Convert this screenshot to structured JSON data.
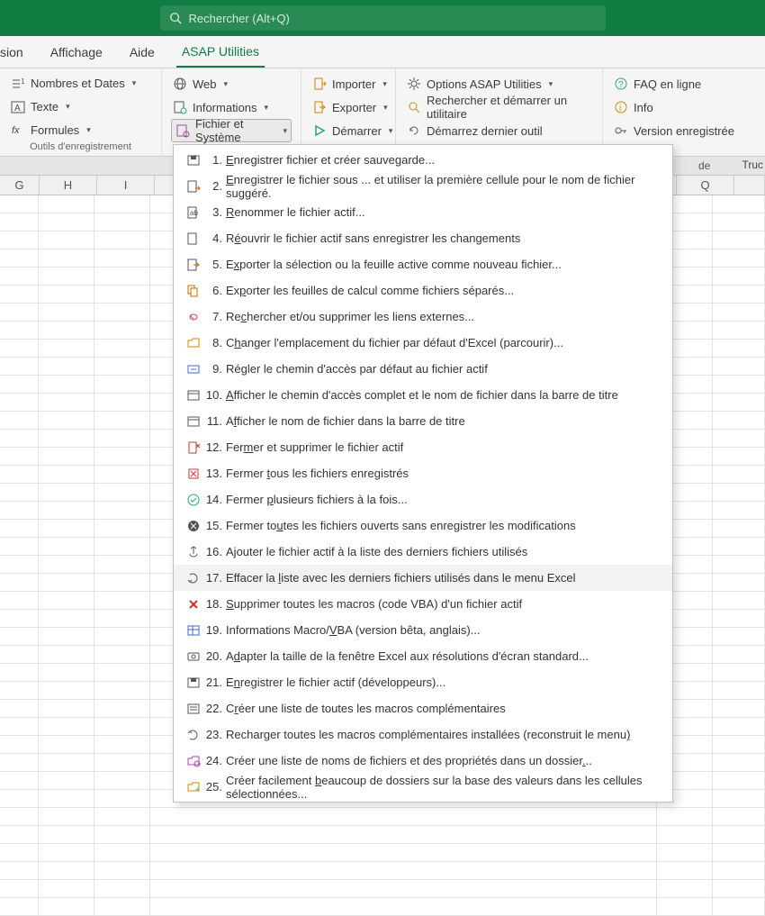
{
  "titlebar": {
    "search_placeholder": "Rechercher (Alt+Q)"
  },
  "tabs": {
    "partial": "sion",
    "affichage": "Affichage",
    "aide": "Aide",
    "asap": "ASAP Utilities"
  },
  "ribbon": {
    "group1": {
      "nombres": "Nombres et Dates",
      "texte": "Texte",
      "formules": "Formules",
      "label": "Outils d'enregistrement"
    },
    "group2": {
      "web": "Web",
      "informations": "Informations",
      "fichier": "Fichier et Système"
    },
    "group3": {
      "importer": "Importer",
      "exporter": "Exporter",
      "demarrer": "Démarrer"
    },
    "group4": {
      "options": "Options ASAP Utilities",
      "rechercher": "Rechercher et démarrer un utilitaire",
      "demarrez": "Démarrez dernier outil"
    },
    "group5": {
      "faq": "FAQ en ligne",
      "info": "Info",
      "version": "Version enregistrée"
    }
  },
  "partial_right_header": "de",
  "truncated_right": "Truc",
  "columns": [
    "G",
    "H",
    "I",
    "",
    "",
    "",
    "",
    "",
    "",
    "",
    "Q"
  ],
  "menu": {
    "items": [
      {
        "n": "1.",
        "u": "E",
        "t": "nregistrer fichier et créer sauvegarde..."
      },
      {
        "n": "2.",
        "u": "E",
        "t": "nregistrer le fichier sous ... et utiliser la première cellule pour le nom de fichier suggéré."
      },
      {
        "n": "3.",
        "u": "R",
        "t": "enommer le fichier actif..."
      },
      {
        "n": "4.",
        "pre": "R",
        "u": "é",
        "t": "ouvrir le fichier actif sans enregistrer les changements"
      },
      {
        "n": "5.",
        "pre": "E",
        "u": "x",
        "t": "porter la sélection ou la feuille active comme nouveau fichier..."
      },
      {
        "n": "6.",
        "pre": "Ex",
        "u": "p",
        "t": "orter les feuilles de calcul comme fichiers séparés..."
      },
      {
        "n": "7.",
        "pre": "Re",
        "u": "c",
        "t": "hercher et/ou supprimer les liens externes..."
      },
      {
        "n": "8.",
        "pre": "C",
        "u": "h",
        "t": "anger l'emplacement du fichier par défaut d'Excel (parcourir)..."
      },
      {
        "n": "9.",
        "pre": "Ré",
        "u": "g",
        "t": "ler le chemin d'accès par défaut au fichier actif"
      },
      {
        "n": "10.",
        "u": "A",
        "t": "fficher le chemin d'accès complet et le nom de fichier dans la barre de titre"
      },
      {
        "n": "11.",
        "pre": "A",
        "u": "f",
        "t": "ficher le nom de fichier dans la barre de titre"
      },
      {
        "n": "12.",
        "pre": "Fer",
        "u": "m",
        "t": "er et supprimer le fichier actif"
      },
      {
        "n": "13.",
        "pre": "Fermer ",
        "u": "t",
        "t": "ous les fichiers enregistrés"
      },
      {
        "n": "14.",
        "pre": "Fermer ",
        "u": "p",
        "t": "lusieurs fichiers à la fois..."
      },
      {
        "n": "15.",
        "pre": "Fermer to",
        "u": "u",
        "t": "tes les fichiers ouverts sans enregistrer les modifications"
      },
      {
        "n": "16.",
        "pre": "A",
        "u": "j",
        "t": "outer le fichier actif  à la liste des derniers fichiers utilisés"
      },
      {
        "n": "17.",
        "pre": "Effacer la ",
        "u": "l",
        "t": "iste avec les derniers fichiers utilisés dans le menu Excel"
      },
      {
        "n": "18.",
        "u": "S",
        "t": "upprimer toutes les macros (code VBA) d'un fichier actif"
      },
      {
        "n": "19.",
        "pre": "Informations Macro/",
        "u": "V",
        "t": "BA (version bêta, anglais)..."
      },
      {
        "n": "20.",
        "pre": "A",
        "u": "d",
        "t": "apter la taille de la fenêtre Excel aux résolutions d'écran standard..."
      },
      {
        "n": "21.",
        "pre": "E",
        "u": "n",
        "t": "registrer le fichier actif  (développeurs)..."
      },
      {
        "n": "22.",
        "pre": "C",
        "u": "r",
        "t": "éer une liste de toutes les macros complémentaires"
      },
      {
        "n": "23.",
        "pre": "Recharger toutes les macros complémentaires installées (reconstruit le menu",
        "u": ")",
        "t": ""
      },
      {
        "n": "24.",
        "pre": "Créer une liste de noms de fichiers et des propriétés dans un dossier",
        "u": ".",
        "t": ".."
      },
      {
        "n": "25.",
        "pre": "Créer facilement ",
        "u": "b",
        "t": "eaucoup de dossiers sur la base des valeurs dans les cellules sélectionnées..."
      }
    ]
  }
}
